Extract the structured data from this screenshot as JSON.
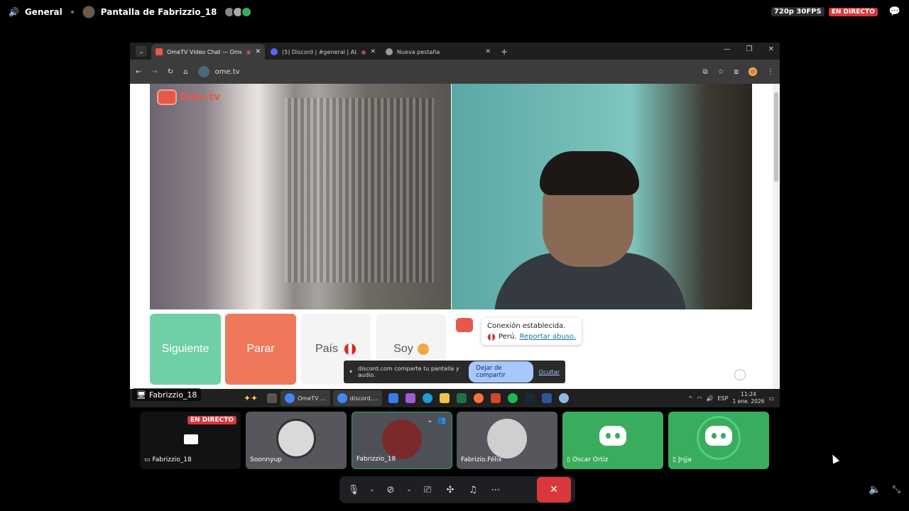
{
  "header": {
    "channel": "General",
    "stream_title": "Pantalla de Fabrizzio_18",
    "quality": "720p 30FPS",
    "live_label": "EN DIRECTO"
  },
  "browser": {
    "tabs": [
      {
        "title": "OmeTV Video Chat — Ome",
        "active": true
      },
      {
        "title": "(5) Discord | #general | AL",
        "active": false
      },
      {
        "title": "Nueva pestaña",
        "active": false
      }
    ],
    "url": "ome.tv"
  },
  "ometv": {
    "logo": "Ome.tv",
    "buttons": {
      "next": "Siguiente",
      "stop": "Parar",
      "country": "País",
      "me": "Soy"
    },
    "chat": {
      "status": "Conexión establecida.",
      "country": "Perú.",
      "report": "Reportar abuso."
    }
  },
  "share_bar": {
    "message": "discord.com comparte tu pantalla y audio.",
    "stop": "Dejar de compartir",
    "hide": "Ocultar"
  },
  "taskbar": {
    "apps": [
      "OmeTV ...",
      "discord...."
    ],
    "lang": "ESP",
    "time": "11:24",
    "date": "1 ene. 2026"
  },
  "stream_label": "Fabrizzio_18",
  "participants": [
    {
      "name": "Fabrizzio_18",
      "badge": "EN DIRECTO"
    },
    {
      "name": "Soonnyup"
    },
    {
      "name": "Fabrizzio_18"
    },
    {
      "name": "Fabrizio.Félix"
    },
    {
      "name": "Oscar Ortiz"
    },
    {
      "name": "Jnjja"
    }
  ],
  "colors": {
    "discord_green": "#3aac5e",
    "live_red": "#da373c",
    "ome_next": "#6fcfa6",
    "ome_stop": "#f0785a"
  }
}
